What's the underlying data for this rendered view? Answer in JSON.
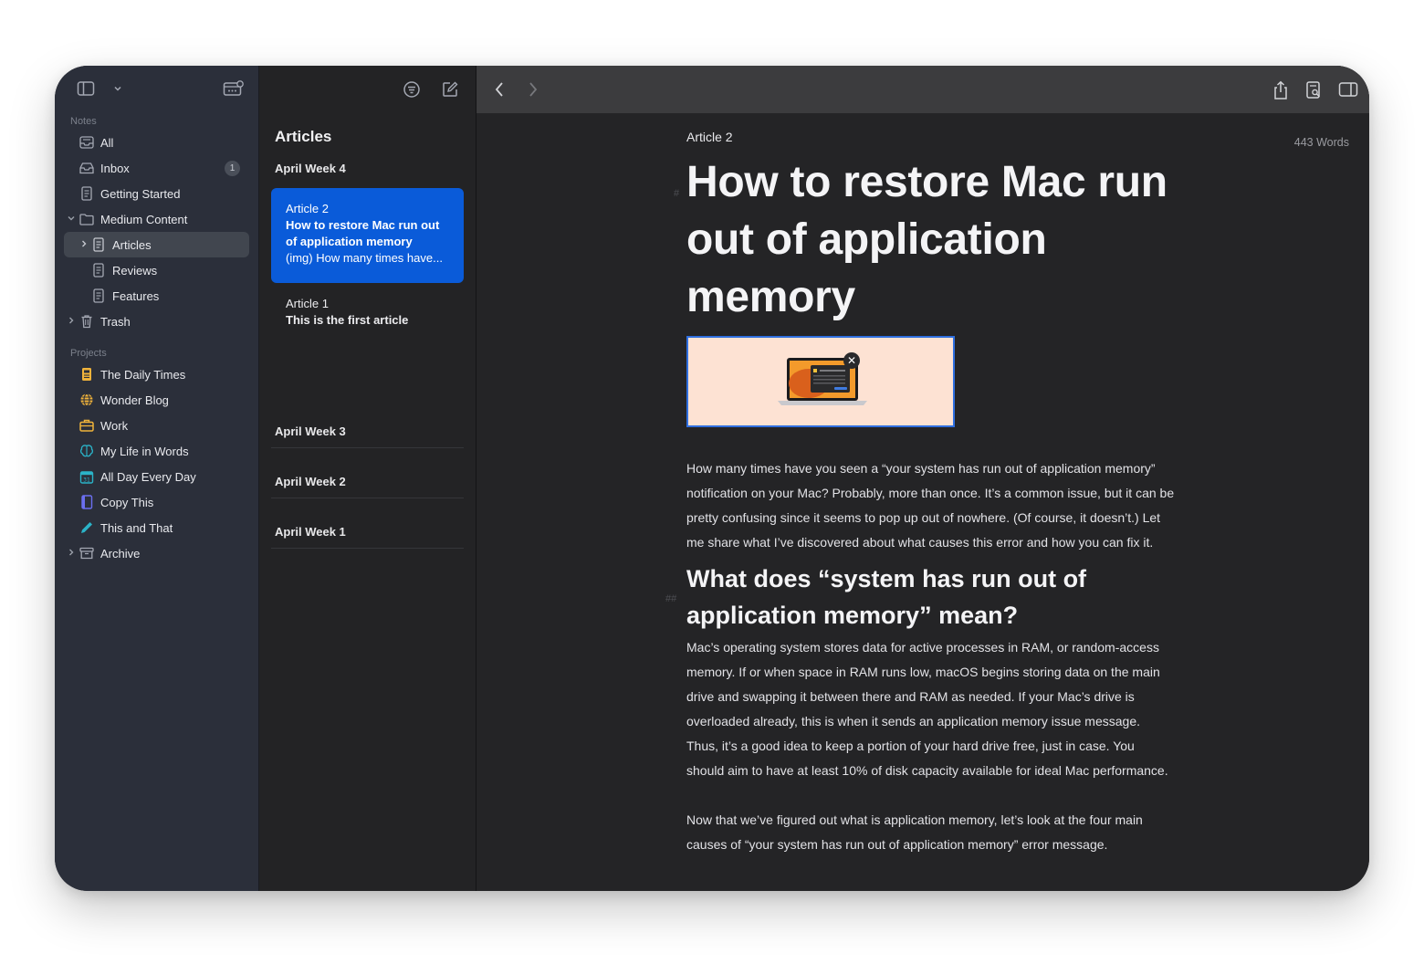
{
  "sidebar": {
    "notes_label": "Notes",
    "projects_label": "Projects",
    "notes_items": [
      {
        "label": "All"
      },
      {
        "label": "Inbox",
        "badge": "1"
      },
      {
        "label": "Getting Started"
      },
      {
        "label": "Medium Content"
      },
      {
        "label": "Articles"
      },
      {
        "label": "Reviews"
      },
      {
        "label": "Features"
      },
      {
        "label": "Trash"
      }
    ],
    "project_items": [
      {
        "label": "The Daily Times",
        "icon_color": "#f0b33b"
      },
      {
        "label": "Wonder Blog",
        "icon_color": "#f0b33b"
      },
      {
        "label": "Work",
        "icon_color": "#f0b33b"
      },
      {
        "label": "My Life in Words",
        "icon_color": "#2bb3c8"
      },
      {
        "label": "All Day Every Day",
        "icon_color": "#2bb3c8"
      },
      {
        "label": "Copy This",
        "icon_color": "#6b6ff0"
      },
      {
        "label": "This and That",
        "icon_color": "#2bb3c8"
      },
      {
        "label": "Archive"
      }
    ]
  },
  "notelist": {
    "title": "Articles",
    "groups": [
      {
        "label": "April Week 4"
      },
      {
        "label": "April Week 3"
      },
      {
        "label": "April Week 2"
      },
      {
        "label": "April Week 1"
      }
    ],
    "notes": [
      {
        "title": "Article 2",
        "subtitle": "How to restore Mac run out of application memory",
        "preview": "(img) How many times have..."
      },
      {
        "title": "Article 1",
        "subtitle": "This is the first article"
      }
    ]
  },
  "editor": {
    "word_count": "443 Words",
    "breadcrumb": "Article 2",
    "h1": "How to restore Mac run out of application memory",
    "h1_mark": "#",
    "paragraph1": "How many times have you seen a “your system has run out of application memory” notification on your Mac? Probably, more than once. It’s a common issue, but it can be pretty confusing since it seems to pop up out of nowhere. (Of course, it doesn’t.) Let me share what I’ve discovered about what causes this error and how you can fix it.",
    "h2_mark": "##",
    "h2": "What does “system has run out of application memory” mean?",
    "paragraph2": "Mac’s operating system stores data for active processes in RAM, or random-access memory. If or when space in RAM runs low, macOS begins storing data on the main drive and swapping it between there and RAM as needed. If your Mac’s drive is overloaded already, this is when it sends an application memory issue message. Thus, it’s a good idea to keep a portion of your hard drive free, just in case. You should aim to have at least 10% of disk capacity available for ideal Mac performance.",
    "paragraph3": "Now that we’ve figured out what is application memory, let’s look at the four main causes of “your system has run out of application memory” error message."
  },
  "colors": {
    "selection_blue": "#0a5bd9",
    "sidebar_bg": "#2b2f3a",
    "editor_bg": "#242426"
  }
}
